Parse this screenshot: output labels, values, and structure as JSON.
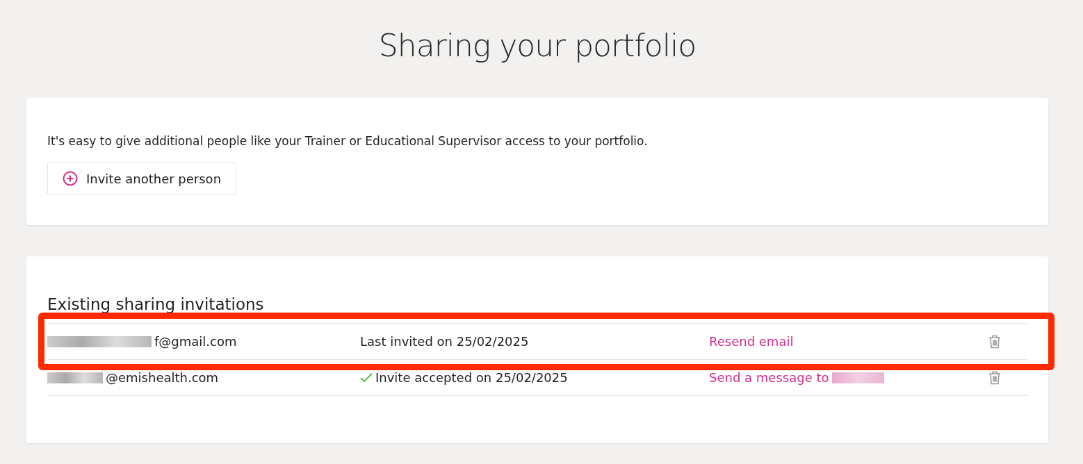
{
  "title": "Sharing your portfolio",
  "intro": {
    "text": "It's easy to give additional people like your Trainer or Educational Supervisor access to your portfolio.",
    "button": "Invite another person"
  },
  "invitations": {
    "heading": "Existing sharing invitations",
    "rows": [
      {
        "email": "f@gmail.com",
        "email_redacted": true,
        "kind": "invited",
        "status": "Last invited on 25/02/2025",
        "action": "Resend email",
        "action_redacted": false,
        "highlighted": true
      },
      {
        "email": "@emishealth.com",
        "email_redacted": true,
        "kind": "accepted",
        "status": "Invite accepted on 25/02/2025",
        "action": "Send a message to",
        "action_redacted": true,
        "highlighted": false
      }
    ]
  }
}
